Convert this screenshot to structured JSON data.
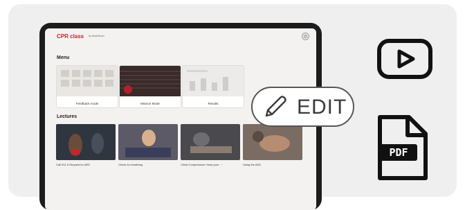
{
  "app": {
    "title": "CPR class",
    "subtitle": "by HeartSmart"
  },
  "menu": {
    "heading": "Menu",
    "items": [
      {
        "label": "Feedback mode"
      },
      {
        "label": "Mission Mode"
      },
      {
        "label": "Results"
      }
    ]
  },
  "lectures": {
    "heading": "Lectures",
    "items": [
      {
        "caption": "Call 911 & Request for AED"
      },
      {
        "caption": "Check for breathing"
      },
      {
        "caption": "Chest Compression: Keep your ···"
      },
      {
        "caption": "Using the AED"
      }
    ]
  },
  "overlay": {
    "edit_label": "EDIT",
    "pdf_label": "PDF"
  },
  "icons": [
    "settings-icon",
    "pencil-icon",
    "video-play-icon",
    "pdf-file-icon"
  ],
  "colors": {
    "accent": "#c4262e",
    "card_bg": "#efefef"
  }
}
